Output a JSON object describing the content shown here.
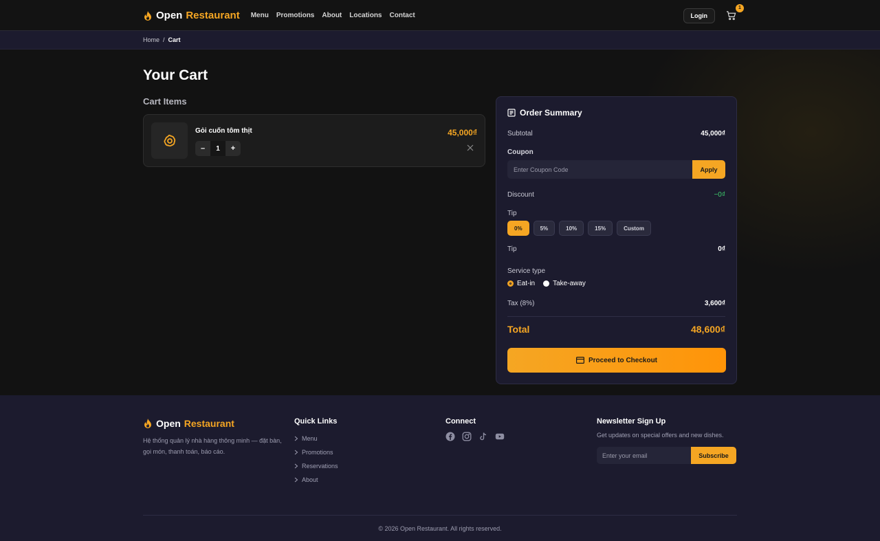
{
  "brand": {
    "name_primary": "Open",
    "name_accent": "Restaurant"
  },
  "nav": {
    "items": [
      "Menu",
      "Promotions",
      "About",
      "Locations",
      "Contact"
    ]
  },
  "header": {
    "login_label": "Login",
    "cart_count": "1"
  },
  "breadcrumb": {
    "home": "Home",
    "separator": "/",
    "current": "Cart"
  },
  "page": {
    "title": "Your Cart",
    "section_title": "Cart Items"
  },
  "cart": {
    "items": [
      {
        "name": "Gỏi cuốn tôm thịt",
        "quantity": "1",
        "price": "45,000₫",
        "minus": "–",
        "plus": "+"
      }
    ]
  },
  "summary": {
    "title": "Order Summary",
    "subtotal_label": "Subtotal",
    "subtotal_value": "45,000₫",
    "coupon_label": "Coupon",
    "coupon_placeholder": "Enter Coupon Code",
    "apply_label": "Apply",
    "discount_label": "Discount",
    "discount_value": "−0₫",
    "tip_label": "Tip",
    "tip_options": [
      "0%",
      "5%",
      "10%",
      "15%",
      "Custom"
    ],
    "tip_selected": "0%",
    "tip_amount_label": "Tip",
    "tip_amount_value": "0₫",
    "service_label": "Service type",
    "service_options": [
      "Eat-in",
      "Take-away"
    ],
    "service_selected": "Eat-in",
    "tax_label": "Tax (8%)",
    "tax_value": "3,600₫",
    "total_label": "Total",
    "total_value": "48,600₫",
    "checkout_label": "Proceed to Checkout"
  },
  "footer": {
    "description": "Hệ thống quản lý nhà hàng thông minh — đặt bàn, gọi món, thanh toán, báo cáo.",
    "quick_links_title": "Quick Links",
    "quick_links": [
      "Menu",
      "Promotions",
      "Reservations",
      "About"
    ],
    "connect_title": "Connect",
    "social_icons": [
      "facebook-icon",
      "instagram-icon",
      "tiktok-icon",
      "youtube-icon"
    ],
    "newsletter_title": "Newsletter Sign Up",
    "newsletter_desc": "Get updates on special offers and new dishes.",
    "email_placeholder": "Enter your email",
    "subscribe_label": "Subscribe",
    "copyright": "© 2026 Open Restaurant. All rights reserved."
  },
  "colors": {
    "accent": "#f5a623",
    "panel": "#1c1b2e",
    "background": "#121212",
    "discount": "#3ecf6e"
  }
}
